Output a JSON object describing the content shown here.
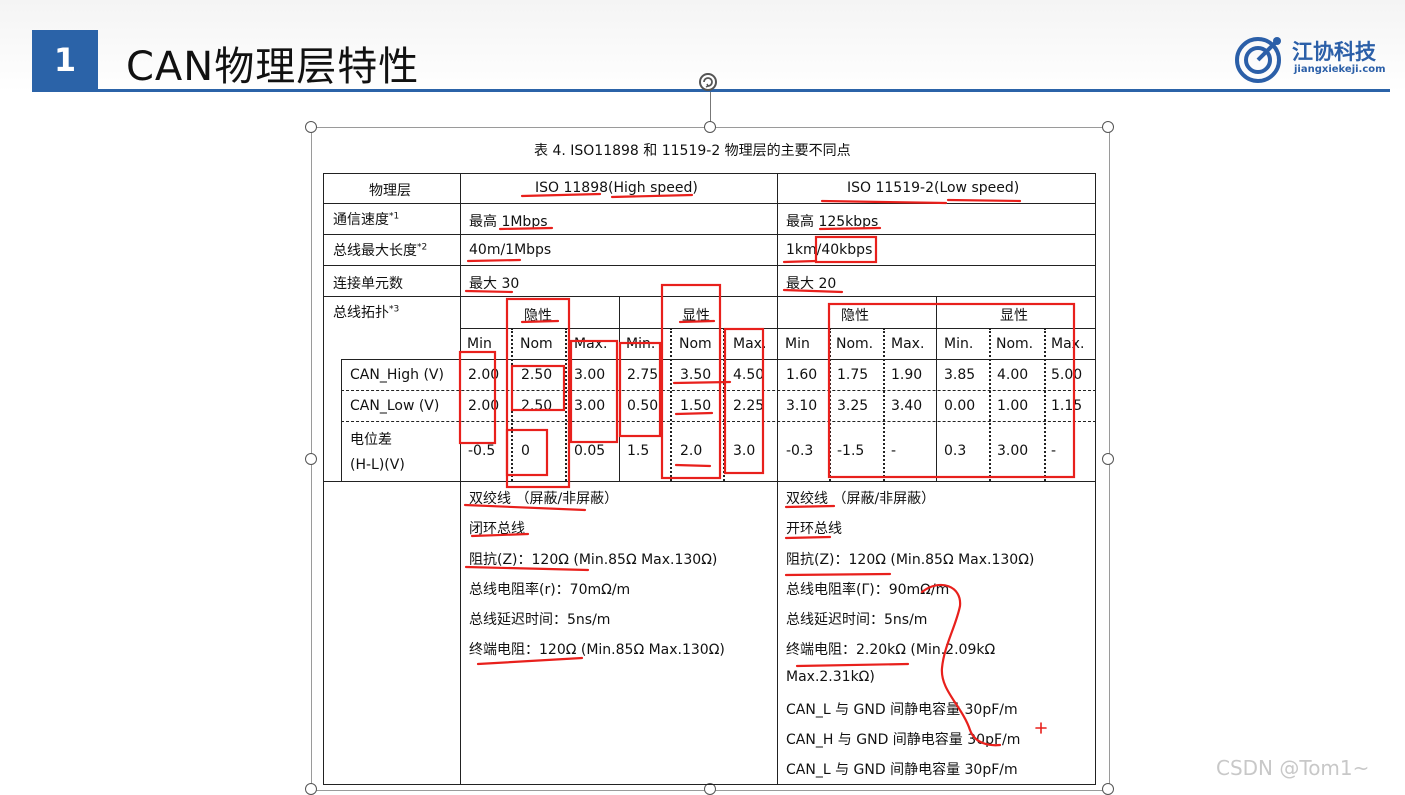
{
  "header": {
    "number": "1",
    "title": "CAN物理层特性",
    "logo_name": "江协科技",
    "logo_url": "jiangxiekeji.com"
  },
  "table": {
    "caption": "表 4.   ISO11898 和 11519-2 物理层的主要不同点",
    "head": {
      "label": "物理层",
      "high": "ISO 11898(High speed)",
      "low": "ISO 11519-2(Low speed)"
    },
    "rows": [
      {
        "label": "通信速度",
        "sup": "*1",
        "high": "最高 1Mbps",
        "low": "最高 125kbps"
      },
      {
        "label": "总线最大长度",
        "sup": "*2",
        "high": "40m/1Mbps",
        "low": "1km/40kbps"
      },
      {
        "label": "连接单元数",
        "sup": "",
        "high": "最大 30",
        "low": "最大 20"
      }
    ],
    "topology": {
      "label": "总线拓扑",
      "sup": "*3",
      "recessive": "隐性",
      "dominant": "显性",
      "high_sub": [
        "Min",
        "Nom",
        "Max.",
        "Min.",
        "Nom",
        "Max."
      ],
      "low_sub": [
        "Min",
        "Nom.",
        "Max.",
        "Min.",
        "Nom.",
        "Max."
      ],
      "signals": [
        {
          "name": "CAN_High (V)",
          "high": [
            "2.00",
            "2.50",
            "3.00",
            "2.75",
            "3.50",
            "4.50"
          ],
          "low": [
            "1.60",
            "1.75",
            "1.90",
            "3.85",
            "4.00",
            "5.00"
          ]
        },
        {
          "name": "CAN_Low (V)",
          "high": [
            "2.00",
            "2.50",
            "3.00",
            "0.50",
            "1.50",
            "2.25"
          ],
          "low": [
            "3.10",
            "3.25",
            "3.40",
            "0.00",
            "1.00",
            "1.15"
          ]
        },
        {
          "name": "电位差",
          "name2": "(H-L)(V)",
          "high": [
            "-0.5",
            "0",
            "0.05",
            "1.5",
            "2.0",
            "3.0"
          ],
          "low": [
            "-0.3",
            "-1.5",
            "-",
            "0.3",
            "3.00",
            "-"
          ]
        }
      ]
    },
    "cable_high": [
      "双绞线 （屏蔽/非屏蔽）",
      "闭环总线",
      "阻抗(Z)：120Ω (Min.85Ω Max.130Ω)",
      "总线电阻率(r)：70mΩ/m",
      "总线延迟时间：5ns/m",
      "终端电阻：120Ω (Min.85Ω Max.130Ω)"
    ],
    "cable_low": [
      "双绞线 （屏蔽/非屏蔽）",
      "开环总线",
      "阻抗(Z)：120Ω (Min.85Ω Max.130Ω)",
      "总线电阻率(Γ)：90mΩ/m",
      "总线延迟时间：5ns/m",
      "终端电阻：2.20kΩ (Min.2.09kΩ",
      "Max.2.31kΩ)",
      "CAN_L 与 GND 间静电容量   30pF/m",
      "CAN_H 与 GND 间静电容量   30pF/m",
      "CAN_L 与 GND 间静电容量   30pF/m"
    ]
  },
  "watermark": "CSDN @Tom1~",
  "colors": {
    "accent": "#2b63a8",
    "annotation": "#e8201c"
  }
}
